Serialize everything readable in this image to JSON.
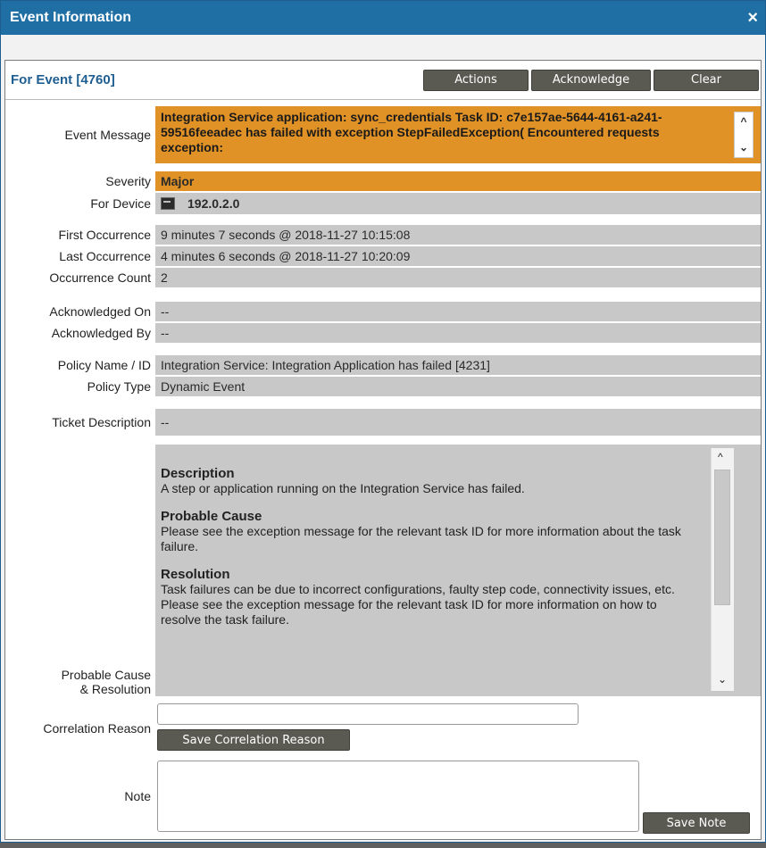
{
  "window": {
    "title": "Event Information",
    "close_glyph": "×"
  },
  "header": {
    "title": "For Event [4760]",
    "buttons": {
      "actions": "Actions",
      "acknowledge": "Acknowledge",
      "clear": "Clear"
    }
  },
  "fields": {
    "event_message": {
      "label": "Event Message",
      "value": "Integration Service application: sync_credentials Task ID: c7e157ae-5644-4161-a241-59516feeadec has failed with exception StepFailedException( Encountered requests exception:"
    },
    "severity": {
      "label": "Severity",
      "value": "Major"
    },
    "for_device": {
      "label": "For Device",
      "value": "192.0.2.0",
      "icon": "device-icon"
    },
    "first_occurrence": {
      "label": "First Occurrence",
      "value": "9 minutes 7 seconds @ 2018-11-27 10:15:08"
    },
    "last_occurrence": {
      "label": "Last Occurrence",
      "value": "4 minutes 6 seconds @ 2018-11-27 10:20:09"
    },
    "occurrence_count": {
      "label": "Occurrence Count",
      "value": "2"
    },
    "acknowledged_on": {
      "label": "Acknowledged On",
      "value": "--"
    },
    "acknowledged_by": {
      "label": "Acknowledged By",
      "value": "--"
    },
    "policy_name": {
      "label": "Policy Name / ID",
      "value": "Integration Service: Integration Application has failed [4231]"
    },
    "policy_type": {
      "label": "Policy Type",
      "value": "Dynamic Event"
    },
    "ticket_description": {
      "label": "Ticket Description",
      "value": "--"
    },
    "probable_cause": {
      "label_line1": "Probable Cause",
      "label_line2": "& Resolution",
      "description_heading": "Description",
      "description_text": "A step or application running on the Integration Service has failed.",
      "cause_heading": "Probable Cause",
      "cause_text": "Please see the exception message for the relevant task ID for more information about the task failure.",
      "resolution_heading": "Resolution",
      "resolution_text1": "Task failures can be due to incorrect configurations, faulty step code, connectivity issues, etc.",
      "resolution_text2": "Please see the exception message for the relevant task ID for more information on how to resolve the task failure."
    },
    "correlation_reason": {
      "label": "Correlation Reason",
      "value": "",
      "button": "Save Correlation Reason"
    },
    "note": {
      "label": "Note",
      "value": "",
      "button": "Save Note"
    }
  },
  "colors": {
    "title_bar": "#1f6fa5",
    "severity_major": "#e19226",
    "field_bg": "#c8c8c8"
  }
}
